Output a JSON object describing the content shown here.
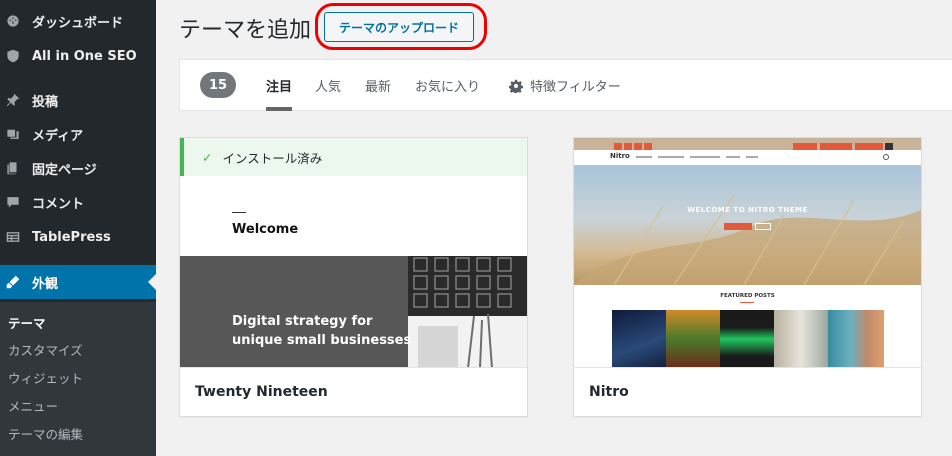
{
  "sidebar": {
    "items": [
      {
        "label": "ダッシュボード",
        "icon": "dashboard-icon"
      },
      {
        "label": "All in One SEO",
        "icon": "shield-icon"
      },
      {
        "label": "投稿",
        "icon": "pin-icon"
      },
      {
        "label": "メディア",
        "icon": "media-icon"
      },
      {
        "label": "固定ページ",
        "icon": "page-icon"
      },
      {
        "label": "コメント",
        "icon": "comment-icon"
      },
      {
        "label": "TablePress",
        "icon": "table-icon"
      },
      {
        "label": "外観",
        "icon": "appearance-icon"
      }
    ],
    "submenu": [
      "テーマ",
      "カスタマイズ",
      "ウィジェット",
      "メニュー",
      "テーマの編集"
    ]
  },
  "header": {
    "title": "テーマを追加",
    "upload_label": "テーマのアップロード"
  },
  "filter_bar": {
    "count": "15",
    "tabs": [
      "注目",
      "人気",
      "最新",
      "お気に入り"
    ],
    "feature_filter": "特徴フィルター"
  },
  "themes": [
    {
      "name": "Twenty Nineteen",
      "installed_label": "インストール済み",
      "preview": {
        "welcome": "Welcome",
        "headline": "Digital strategy for\nunique small businesses"
      }
    },
    {
      "name": "Nitro",
      "preview": {
        "logo": "Nitro",
        "hero_title": "WELCOME TO NITRO THEME",
        "featured": "FEATURED POSTS"
      }
    }
  ],
  "colors": {
    "sidebar_bg": "#23282d",
    "accent": "#0073aa",
    "installed_green": "#46b450",
    "highlight_ring": "#ee0000"
  }
}
